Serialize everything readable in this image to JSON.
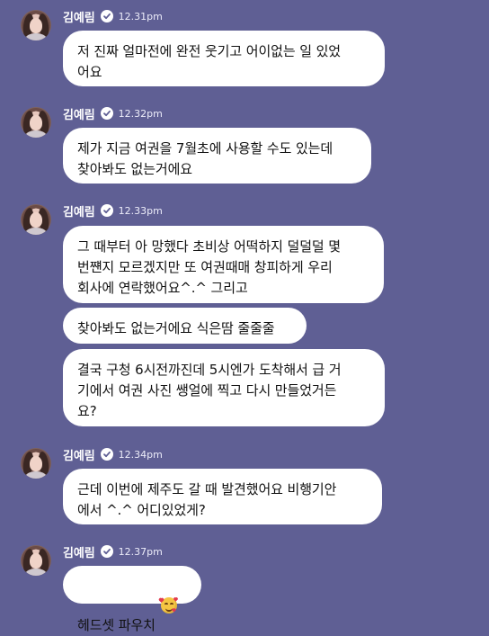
{
  "chat": {
    "messages": [
      {
        "sender": "김예림",
        "time": "12.31pm",
        "bubbles": [
          "저 진짜 얼마전에 완전 웃기고 어이없는 일 있었\n어요"
        ]
      },
      {
        "sender": "김예림",
        "time": "12.32pm",
        "bubbles": [
          "제가 지금 여권을 7월초에 사용할 수도 있는데\n찾아봐도 없는거에요"
        ]
      },
      {
        "sender": "김예림",
        "time": "12.33pm",
        "bubbles": [
          "그 때부터 아 망했다 초비상 어떡하지 덜덜덜 몇\n번쨴지 모르겠지만 또 여권때매 창피하게 우리\n회사에 연락했어요^.^ 그리고",
          "찾아봐도 없는거에요 식은땀 줄줄줄",
          "결국 구청 6시전까진데 5시엔가 도착해서 급 거\n기에서 여권 사진 쌩얼에 찍고 다시 만들었거든\n요?"
        ]
      },
      {
        "sender": "김예림",
        "time": "12.34pm",
        "bubbles": [
          "근데 이번에 제주도 갈 때 발견했어요 비행기안\n에서 ^.^ 어디있었게?"
        ]
      },
      {
        "sender": "김예림",
        "time": "12.37pm",
        "bubbles": [
          "헤드셋 파우치"
        ],
        "emoji": "smiling-face-with-hearts-icon"
      }
    ]
  }
}
